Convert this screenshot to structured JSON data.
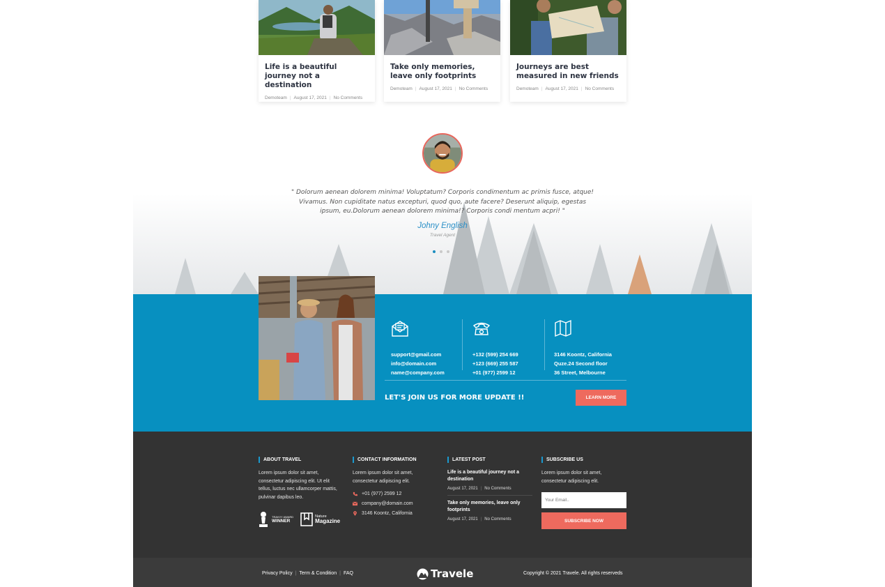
{
  "blog": {
    "posts": [
      {
        "title": "Life is a beautiful journey not a destination",
        "author": "Demoteam",
        "date": "August 17, 2021",
        "comments": "No Comments"
      },
      {
        "title": "Take only memories, leave only footprints",
        "author": "Demoteam",
        "date": "August 17, 2021",
        "comments": "No Comments"
      },
      {
        "title": "Journeys are best measured in new friends",
        "author": "Demoteam",
        "date": "August 17, 2021",
        "comments": "No Comments"
      }
    ]
  },
  "testimonial": {
    "quote": "\" Dolorum aenean dolorem minima! Voluptatum? Corporis condimentum ac primis fusce, atque! Vivamus. Non cupiditate natus excepturi, quod quo, aute facere? Deserunt aliquip, egestas ipsum, eu.Dolorum aenean dolorem minima!? Corporis condi mentum acpri! \"",
    "author": "Johny English",
    "role": "Travel Agent",
    "active_slide": 1,
    "slide_count": 3
  },
  "contact": {
    "emails": [
      "support@gmail.com",
      "info@domain.com",
      "name@company.com"
    ],
    "phones": [
      "+132 (599) 254 669",
      "+123 (669) 255 587",
      "+01 (977) 2599 12"
    ],
    "address": [
      "3146 Koontz, California",
      "Quze.24 Second floor",
      "36 Street, Melbourne"
    ],
    "join_text": "LET'S JOIN US FOR MORE UPDATE !!",
    "learn_more": "LEARN MORE"
  },
  "footer": {
    "about": {
      "heading": "ABOUT TRAVEL",
      "text": "Lorem ipsum dolor sit amet, consectetur adipiscing elit. Ut elit tellus, luctus nec ullamcorper mattis, pulvinar dapibus leo.",
      "award1_small": "TRAVVY AWARD",
      "award1_big": "WINNER",
      "award2_small": "Nature",
      "award2_big": "Magazine"
    },
    "contact_info": {
      "heading": "CONTACT INFORMATION",
      "text": "Lorem ipsum dolor sit amet, consectetur adipiscing elit.",
      "phone": "+01 (977) 2599 12",
      "email": "company@domain.com",
      "address": "3146 Koontz, California"
    },
    "latest": {
      "heading": "LATEST POST",
      "posts": [
        {
          "title": "Life is a beautiful journey not a destination",
          "date": "August 17, 2021",
          "comments": "No Comments"
        },
        {
          "title": "Take only memories, leave only footprints",
          "date": "August 17, 2021",
          "comments": "No Comments"
        }
      ]
    },
    "subscribe": {
      "heading": "SUBSCRIBE US",
      "text": "Lorem ipsum dolor sit amet, consectetur adipiscing elit.",
      "placeholder": "Your Email..",
      "button": "SUBSCRIBE NOW"
    }
  },
  "bottom": {
    "links": [
      "Privacy Policy",
      "Term & Condition",
      "FAQ"
    ],
    "logo_text": "Travele",
    "copyright": "Copyright © 2021 Travele. All rights reserveds"
  },
  "colors": {
    "accent_blue": "#0790c0",
    "accent_red": "#ee6a5e",
    "footer_dark": "#333333",
    "link_blue": "#2a8fc7"
  }
}
